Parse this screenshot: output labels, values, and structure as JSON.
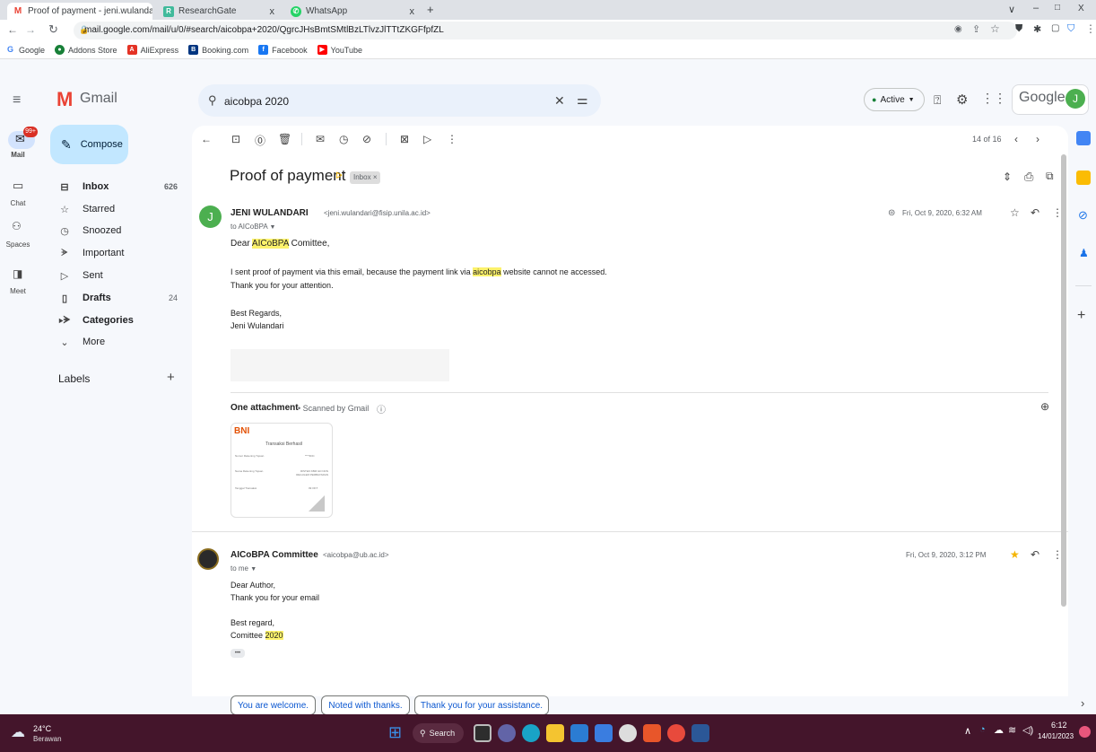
{
  "browser": {
    "tabs": [
      {
        "label": "Proof of payment - jeni.wulanda",
        "close": "x"
      },
      {
        "label": "ResearchGate",
        "close": "x"
      },
      {
        "label": "WhatsApp",
        "close": "x"
      }
    ],
    "new_tab": "+",
    "window_controls": {
      "min": "–",
      "restore": "□",
      "close": "X",
      "dropdown": "∨"
    },
    "url": "mail.google.com/mail/u/0/#search/aicobpa+2020/QgrcJHsBmtSMtlBzLTlvzJlTTtZKGFfpfZL",
    "bookmarks": [
      "Google",
      "Addons Store",
      "AliExpress",
      "Booking.com",
      "Facebook",
      "YouTube"
    ]
  },
  "gmail": {
    "logo": "Gmail",
    "search_value": "aicobpa 2020",
    "status": "Active",
    "account_badge": "Google",
    "avatar_letter": "J",
    "compose": "Compose",
    "rail": {
      "mail": "Mail",
      "chat": "Chat",
      "spaces": "Spaces",
      "meet": "Meet",
      "badge": "99+"
    },
    "nav": [
      {
        "label": "Inbox",
        "count": "626"
      },
      {
        "label": "Starred",
        "count": ""
      },
      {
        "label": "Snoozed",
        "count": ""
      },
      {
        "label": "Important",
        "count": ""
      },
      {
        "label": "Sent",
        "count": ""
      },
      {
        "label": "Drafts",
        "count": "24"
      },
      {
        "label": "Categories",
        "count": ""
      },
      {
        "label": "More",
        "count": ""
      }
    ],
    "labels_heading": "Labels",
    "labels_add": "+"
  },
  "thread": {
    "pager": "14 of 16",
    "subject": "Proof of payment",
    "label_chip": "Inbox",
    "label_chip_close": "×",
    "messages": [
      {
        "avatar": "J",
        "sender": "JENI WULANDARI",
        "email": "<jeni.wulandari@fisip.unila.ac.id>",
        "to": "to AICoBPA",
        "date": "Fri, Oct 9, 2020, 6:32 AM",
        "greeting_pre": "Dear ",
        "greeting_hl": "AICoBPA",
        "greeting_post": " Comittee,",
        "line1_pre": "I sent proof of payment via this email, because the payment link via ",
        "line1_hl": "aicobpa",
        "line1_post": " website cannot ne accessed.",
        "line2": "Thank you for your attention.",
        "signoff": "Best Regards,",
        "signature": "Jeni Wulandari",
        "attachment_title": "One attachment",
        "attachment_scan": "•  Scanned by Gmail",
        "attachment_preview": {
          "bank": "BNI",
          "heading": "Transaksi Berhasil",
          "rows": [
            [
              "Nomor Rekening Tujuan",
              "****4DC"
            ],
            [
              "Nama Rekening Tujuan",
              "RISTEK KBM GD NON REGULER PEMBAYARAN"
            ],
            [
              "Tanggal Transaksi",
              "09 OKT"
            ]
          ]
        }
      },
      {
        "sender": "AICoBPA Committee",
        "email": "<aicobpa@ub.ac.id>",
        "to": "to me",
        "date": "Fri, Oct 9, 2020, 3:12 PM",
        "line1": "Dear Author,",
        "line2": "Thank you for your email",
        "signoff": "Best regard,",
        "sig_pre": "Comittee ",
        "sig_hl": "2020",
        "ellipsis": "•••"
      }
    ],
    "smart_replies": [
      "You are welcome.",
      "Noted with thanks.",
      "Thank you for your assistance."
    ]
  },
  "taskbar": {
    "weather_temp": "24°C",
    "weather_desc": "Berawan",
    "search": "Search",
    "time": "6:12",
    "date": "14/01/2023"
  },
  "colors": {
    "gmail_red": "#ea4335",
    "active_green": "#188038",
    "avatar_green": "#4caf50",
    "compose_blue": "#c2e7ff",
    "star_yellow": "#f4b400"
  }
}
